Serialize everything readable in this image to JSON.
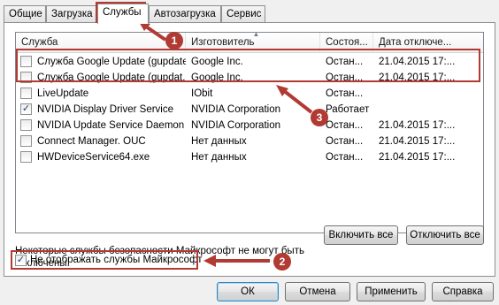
{
  "tabs": [
    "Общие",
    "Загрузка",
    "Службы",
    "Автозагрузка",
    "Сервис"
  ],
  "columns": [
    "Служба",
    "Изготовитель",
    "Состоя...",
    "Дата отключе..."
  ],
  "rows": [
    {
      "name": "Служба Google Update (gupdate)",
      "maker": "Google Inc.",
      "state": "Остан...",
      "date": "21.04.2015 17:...",
      "checked": false
    },
    {
      "name": "Служба Google Update (gupdat...",
      "maker": "Google Inc.",
      "state": "Остан...",
      "date": "21.04.2015 17:...",
      "checked": false
    },
    {
      "name": "LiveUpdate",
      "maker": "IObit",
      "state": "Остан...",
      "date": "",
      "checked": false
    },
    {
      "name": "NVIDIA Display Driver Service",
      "maker": "NVIDIA Corporation",
      "state": "Работает",
      "date": "",
      "checked": true
    },
    {
      "name": "NVIDIA Update Service Daemon",
      "maker": "NVIDIA Corporation",
      "state": "Остан...",
      "date": "21.04.2015 17:...",
      "checked": false
    },
    {
      "name": "Connect Manager. OUC",
      "maker": "Нет данных",
      "state": "Остан...",
      "date": "21.04.2015 17:...",
      "checked": false
    },
    {
      "name": "HWDeviceService64.exe",
      "maker": "Нет данных",
      "state": "Остан...",
      "date": "21.04.2015 17:...",
      "checked": false
    }
  ],
  "note": "Некоторые службы безопасности Майкрософт не могут быть отключены.",
  "enable_all": "Включить все",
  "disable_all": "Отключить все",
  "hide_ms_label": "Не отображать службы Майкрософт",
  "hide_ms_checked": true,
  "ok": "ОК",
  "cancel": "Отмена",
  "apply": "Применить",
  "help": "Справка",
  "check_glyph": "✓",
  "badges": [
    "1",
    "2",
    "3"
  ],
  "annotation_color": "#b13a33"
}
